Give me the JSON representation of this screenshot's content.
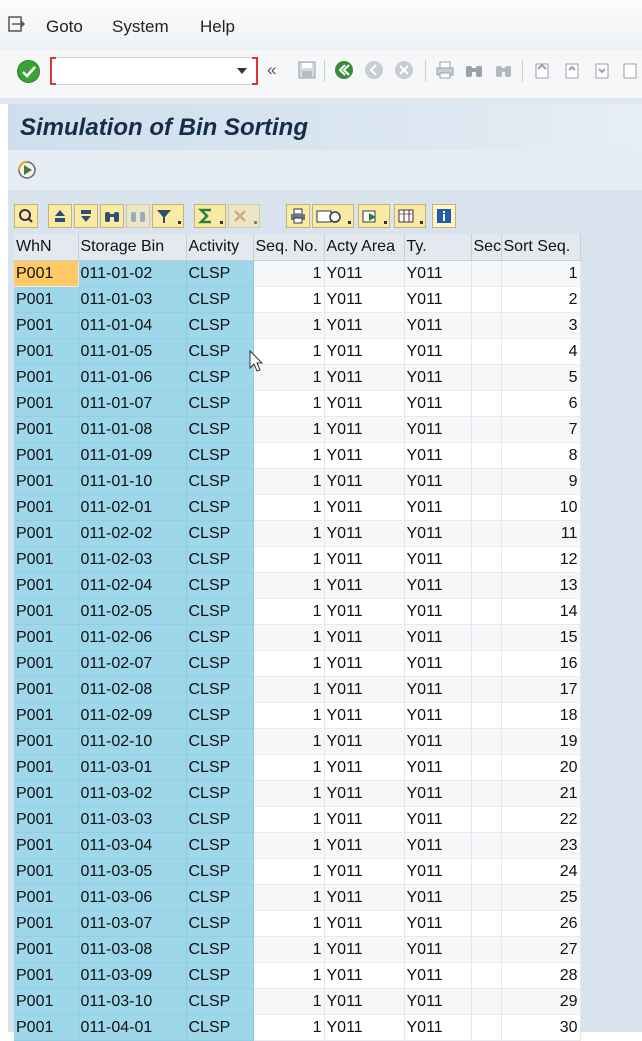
{
  "menu": {
    "items": [
      "Goto",
      "System",
      "Help"
    ]
  },
  "toolbar": {
    "command_value": "",
    "nav_glyph": "«"
  },
  "page": {
    "title": "Simulation of Bin Sorting"
  },
  "grid": {
    "columns": [
      "WhN",
      "Storage Bin",
      "Activity",
      "Seq. No.",
      "Acty Area",
      "Ty.",
      "Sec",
      "Sort Seq."
    ],
    "rows": [
      [
        "P001",
        "011-01-02",
        "CLSP",
        "1",
        "Y011",
        "Y011",
        "",
        "1"
      ],
      [
        "P001",
        "011-01-03",
        "CLSP",
        "1",
        "Y011",
        "Y011",
        "",
        "2"
      ],
      [
        "P001",
        "011-01-04",
        "CLSP",
        "1",
        "Y011",
        "Y011",
        "",
        "3"
      ],
      [
        "P001",
        "011-01-05",
        "CLSP",
        "1",
        "Y011",
        "Y011",
        "",
        "4"
      ],
      [
        "P001",
        "011-01-06",
        "CLSP",
        "1",
        "Y011",
        "Y011",
        "",
        "5"
      ],
      [
        "P001",
        "011-01-07",
        "CLSP",
        "1",
        "Y011",
        "Y011",
        "",
        "6"
      ],
      [
        "P001",
        "011-01-08",
        "CLSP",
        "1",
        "Y011",
        "Y011",
        "",
        "7"
      ],
      [
        "P001",
        "011-01-09",
        "CLSP",
        "1",
        "Y011",
        "Y011",
        "",
        "8"
      ],
      [
        "P001",
        "011-01-10",
        "CLSP",
        "1",
        "Y011",
        "Y011",
        "",
        "9"
      ],
      [
        "P001",
        "011-02-01",
        "CLSP",
        "1",
        "Y011",
        "Y011",
        "",
        "10"
      ],
      [
        "P001",
        "011-02-02",
        "CLSP",
        "1",
        "Y011",
        "Y011",
        "",
        "11"
      ],
      [
        "P001",
        "011-02-03",
        "CLSP",
        "1",
        "Y011",
        "Y011",
        "",
        "12"
      ],
      [
        "P001",
        "011-02-04",
        "CLSP",
        "1",
        "Y011",
        "Y011",
        "",
        "13"
      ],
      [
        "P001",
        "011-02-05",
        "CLSP",
        "1",
        "Y011",
        "Y011",
        "",
        "14"
      ],
      [
        "P001",
        "011-02-06",
        "CLSP",
        "1",
        "Y011",
        "Y011",
        "",
        "15"
      ],
      [
        "P001",
        "011-02-07",
        "CLSP",
        "1",
        "Y011",
        "Y011",
        "",
        "16"
      ],
      [
        "P001",
        "011-02-08",
        "CLSP",
        "1",
        "Y011",
        "Y011",
        "",
        "17"
      ],
      [
        "P001",
        "011-02-09",
        "CLSP",
        "1",
        "Y011",
        "Y011",
        "",
        "18"
      ],
      [
        "P001",
        "011-02-10",
        "CLSP",
        "1",
        "Y011",
        "Y011",
        "",
        "19"
      ],
      [
        "P001",
        "011-03-01",
        "CLSP",
        "1",
        "Y011",
        "Y011",
        "",
        "20"
      ],
      [
        "P001",
        "011-03-02",
        "CLSP",
        "1",
        "Y011",
        "Y011",
        "",
        "21"
      ],
      [
        "P001",
        "011-03-03",
        "CLSP",
        "1",
        "Y011",
        "Y011",
        "",
        "22"
      ],
      [
        "P001",
        "011-03-04",
        "CLSP",
        "1",
        "Y011",
        "Y011",
        "",
        "23"
      ],
      [
        "P001",
        "011-03-05",
        "CLSP",
        "1",
        "Y011",
        "Y011",
        "",
        "24"
      ],
      [
        "P001",
        "011-03-06",
        "CLSP",
        "1",
        "Y011",
        "Y011",
        "",
        "25"
      ],
      [
        "P001",
        "011-03-07",
        "CLSP",
        "1",
        "Y011",
        "Y011",
        "",
        "26"
      ],
      [
        "P001",
        "011-03-08",
        "CLSP",
        "1",
        "Y011",
        "Y011",
        "",
        "27"
      ],
      [
        "P001",
        "011-03-09",
        "CLSP",
        "1",
        "Y011",
        "Y011",
        "",
        "28"
      ],
      [
        "P001",
        "011-03-10",
        "CLSP",
        "1",
        "Y011",
        "Y011",
        "",
        "29"
      ],
      [
        "P001",
        "011-04-01",
        "CLSP",
        "1",
        "Y011",
        "Y011",
        "",
        "30"
      ]
    ]
  },
  "colors": {
    "key_column": "#9ed6ea",
    "selected_cell": "#ffc966",
    "title_text": "#152d46",
    "ok_button": "#3aa335"
  },
  "icons": {
    "menu": "session-menu-icon",
    "ok": "check-icon",
    "execute": "execute-icon",
    "alv": [
      "details-icon",
      "sort-ascending-icon",
      "sort-descending-icon",
      "find-icon",
      "find-next-icon",
      "filter-icon",
      "sum-icon",
      "subtotal-icon",
      "print-preview-icon",
      "export-icon",
      "views-icon",
      "layout-icon",
      "info-icon"
    ]
  }
}
